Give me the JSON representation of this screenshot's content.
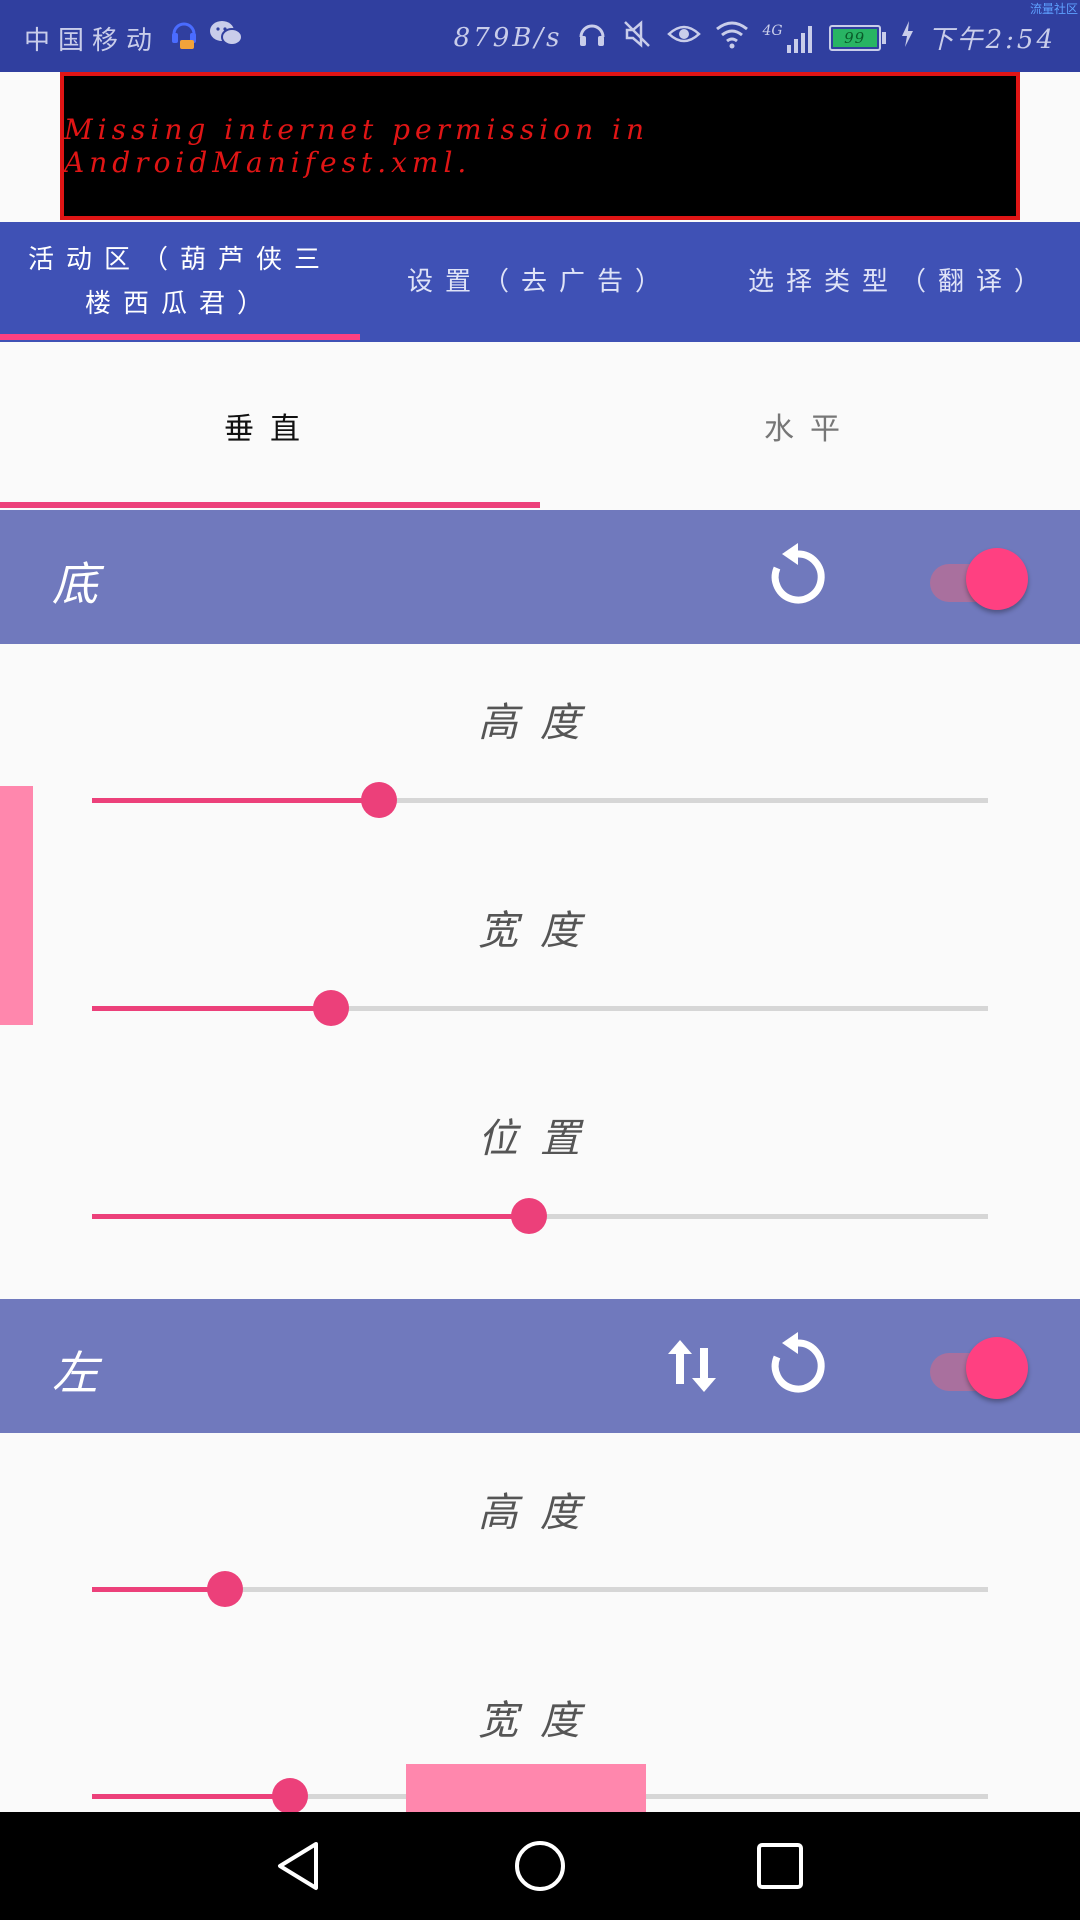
{
  "status_bar": {
    "carrier": "中国移动",
    "speed": "879B/s",
    "network": "4G",
    "battery": "99",
    "time": "下午2:54",
    "corner_tag": "流量社区",
    "icons": [
      "headset-notification-icon",
      "wechat-icon",
      "headphones-icon",
      "mute-icon",
      "eye-icon",
      "wifi-icon",
      "signal-icon",
      "battery-icon",
      "charging-icon"
    ]
  },
  "ad_banner": {
    "text": "Missing internet permission in AndroidManifest.xml."
  },
  "tabs": [
    {
      "label": "活动区（葫芦侠三\n楼西瓜君）",
      "active": true
    },
    {
      "label": "设置（去广告）",
      "active": false
    },
    {
      "label": "选择类型（翻译）",
      "active": false
    }
  ],
  "sub_tabs": [
    {
      "label": "垂直",
      "active": true
    },
    {
      "label": "水平",
      "active": false
    }
  ],
  "sections": [
    {
      "title": "底",
      "icons": [
        "reset-icon"
      ],
      "toggle_on": true,
      "sliders": [
        {
          "label": "高度",
          "value": 0.32
        },
        {
          "label": "宽度",
          "value": 0.267
        },
        {
          "label": "位置",
          "value": 0.488
        }
      ]
    },
    {
      "title": "左",
      "icons": [
        "swap-vertical-icon",
        "reset-icon"
      ],
      "toggle_on": true,
      "sliders": [
        {
          "label": "高度",
          "value": 0.148
        },
        {
          "label": "宽度",
          "value": 0.221
        }
      ]
    }
  ],
  "colors": {
    "status_bar": "#303f9f",
    "primary": "#3f51b5",
    "section_header": "#7079bd",
    "accent": "#ff4081",
    "ad_text": "#e01515",
    "overlay": "#ff87ad"
  },
  "nav_bar": [
    "back-icon",
    "home-icon",
    "recents-icon"
  ]
}
